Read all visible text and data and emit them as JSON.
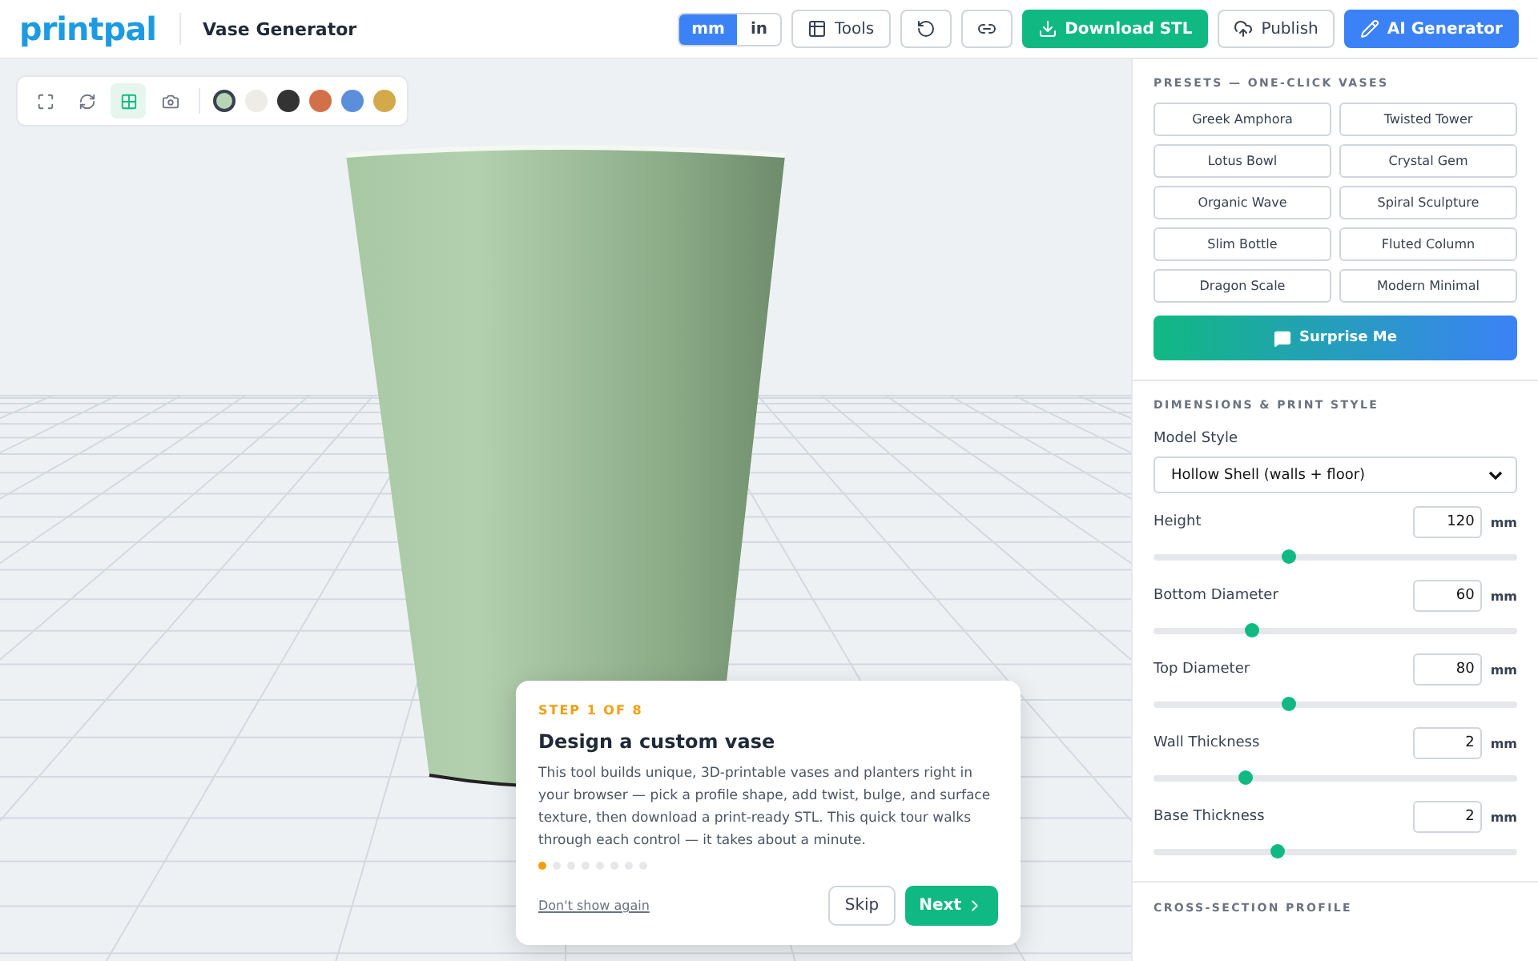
{
  "header": {
    "logo": "printpal",
    "title": "Vase Generator",
    "units": [
      {
        "label": "mm",
        "selected": true
      },
      {
        "label": "in",
        "selected": false
      }
    ],
    "buttons": [
      {
        "kind": "tools",
        "label": "Tools"
      },
      {
        "kind": "undo"
      },
      {
        "kind": "link"
      },
      {
        "kind": "download",
        "label": "Download STL"
      },
      {
        "kind": "publish",
        "label": "Publish"
      },
      {
        "kind": "ai",
        "label": "AI Generator"
      }
    ]
  },
  "viewport": {
    "tools": [
      {
        "kind": "fullscreen",
        "selected": false
      },
      {
        "kind": "rotate",
        "selected": false
      },
      {
        "kind": "grid",
        "selected": true
      },
      {
        "kind": "camera",
        "selected": false
      }
    ],
    "swatches": [
      {
        "color": "#b7d4b4",
        "selected": true
      },
      {
        "color": "#eeece6",
        "selected": false
      },
      {
        "color": "#333333",
        "selected": false
      },
      {
        "color": "#d2704a",
        "selected": false
      },
      {
        "color": "#5b8fdc",
        "selected": false
      },
      {
        "color": "#d4a94a",
        "selected": false
      }
    ]
  },
  "tour": {
    "step": "STEP 1 OF 8",
    "title": "Design a custom vase",
    "body": "This tool builds unique, 3D-printable vases and planters right in your browser — pick a profile shape, add twist, bulge, and surface texture, then download a print-ready STL. This quick tour walks through each control — it takes about a minute.",
    "dots": [
      {
        "selected": true
      },
      {
        "selected": false
      },
      {
        "selected": false
      },
      {
        "selected": false
      },
      {
        "selected": false
      },
      {
        "selected": false
      },
      {
        "selected": false
      },
      {
        "selected": false
      }
    ],
    "dont_show": "Don't show again",
    "skip": "Skip",
    "next": "Next"
  },
  "sidebar": {
    "presets_heading": "PRESETS — ONE-CLICK VASES",
    "presets": [
      "Greek Amphora",
      "Twisted Tower",
      "Lotus Bowl",
      "Crystal Gem",
      "Organic Wave",
      "Spiral Sculpture",
      "Slim Bottle",
      "Fluted Column",
      "Dragon Scale",
      "Modern Minimal"
    ],
    "surprise": "Surprise Me",
    "dimensions_heading": "DIMENSIONS & PRINT STYLE",
    "model_style_label": "Model Style",
    "model_style": "Hollow Shell (walls + floor)",
    "params": [
      {
        "label": "Height",
        "value": "120",
        "unit": "mm",
        "level": 0.37
      },
      {
        "label": "Bottom Diameter",
        "value": "60",
        "unit": "mm",
        "level": 0.27
      },
      {
        "label": "Top Diameter",
        "value": "80",
        "unit": "mm",
        "level": 0.37
      },
      {
        "label": "Wall Thickness",
        "value": "2",
        "unit": "mm",
        "level": 0.25
      },
      {
        "label": "Base Thickness",
        "value": "2",
        "unit": "mm",
        "level": 0.34
      }
    ],
    "next_heading": "CROSS-SECTION PROFILE"
  }
}
